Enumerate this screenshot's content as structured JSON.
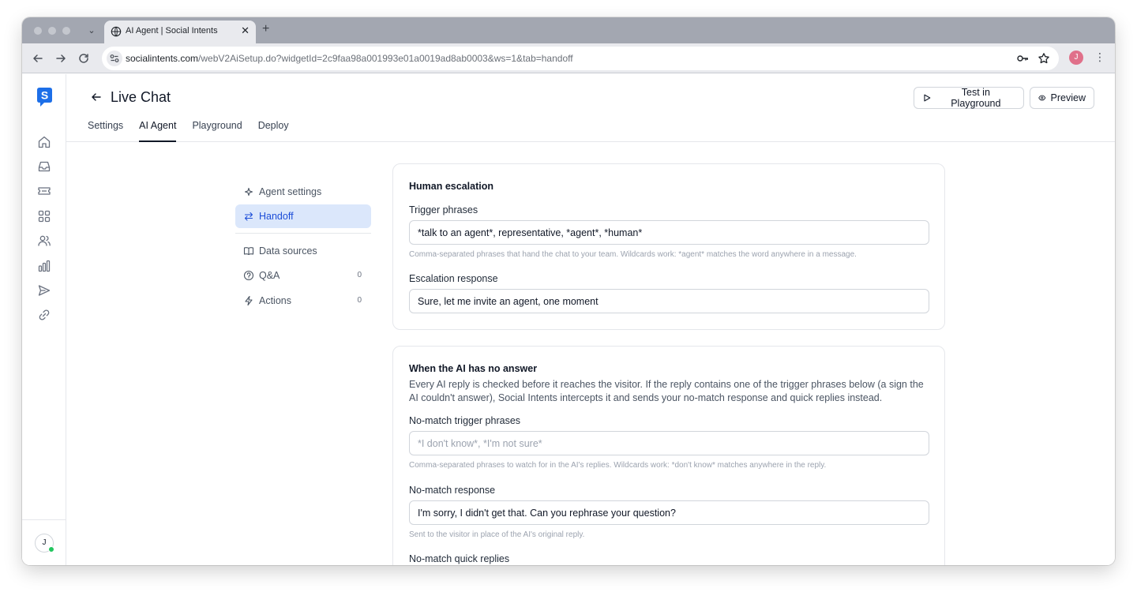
{
  "browser": {
    "tab_title": "AI Agent | Social Intents",
    "tab_close": "✕",
    "new_tab": "+",
    "url_host": "socialintents.com",
    "url_path": "/webV2AiSetup.do?widgetId=2c9faa98a001993e01a0019ad8ab0003&ws=1&tab=handoff",
    "profile_initial": "J"
  },
  "header": {
    "title": "Live Chat",
    "test_button": "Test in Playground",
    "preview_button": "Preview",
    "tabs": [
      {
        "label": "Settings"
      },
      {
        "label": "AI Agent"
      },
      {
        "label": "Playground"
      },
      {
        "label": "Deploy"
      }
    ]
  },
  "rail": {
    "user_initial": "J",
    "icons": [
      "home-icon",
      "inbox-icon",
      "ticket-icon",
      "apps-icon",
      "users-icon",
      "analytics-icon",
      "send-icon",
      "link-icon"
    ]
  },
  "submenu": {
    "agent_settings": "Agent settings",
    "handoff": "Handoff",
    "data_sources": "Data sources",
    "qa": "Q&A",
    "qa_count": "0",
    "actions": "Actions",
    "actions_count": "0"
  },
  "escalation": {
    "title": "Human escalation",
    "trigger_label": "Trigger phrases",
    "trigger_value": "*talk to an agent*, representative, *agent*, *human*",
    "trigger_help": "Comma-separated phrases that hand the chat to your team. Wildcards work: *agent* matches the word anywhere in a message.",
    "response_label": "Escalation response",
    "response_value": "Sure, let me invite an agent, one moment"
  },
  "no_answer": {
    "title": "When the AI has no answer",
    "description": "Every AI reply is checked before it reaches the visitor. If the reply contains one of the trigger phrases below (a sign the AI couldn't answer), Social Intents intercepts it and sends your no-match response and quick replies instead.",
    "trigger_label": "No-match trigger phrases",
    "trigger_placeholder": "*I don't know*, *I'm not sure*",
    "trigger_help": "Comma-separated phrases to watch for in the AI's replies. Wildcards work: *don't know* matches anywhere in the reply.",
    "response_label": "No-match response",
    "response_value": "I'm sorry, I didn't get that.  Can you rephrase your question?",
    "response_help": "Sent to the visitor in place of the AI's original reply.",
    "quick_replies_label": "No-match quick replies"
  },
  "colors": {
    "brand": "#1d6fe8",
    "active_bg": "#dbe7fb",
    "active_text": "#1d4ed8",
    "online": "#22c55e"
  }
}
